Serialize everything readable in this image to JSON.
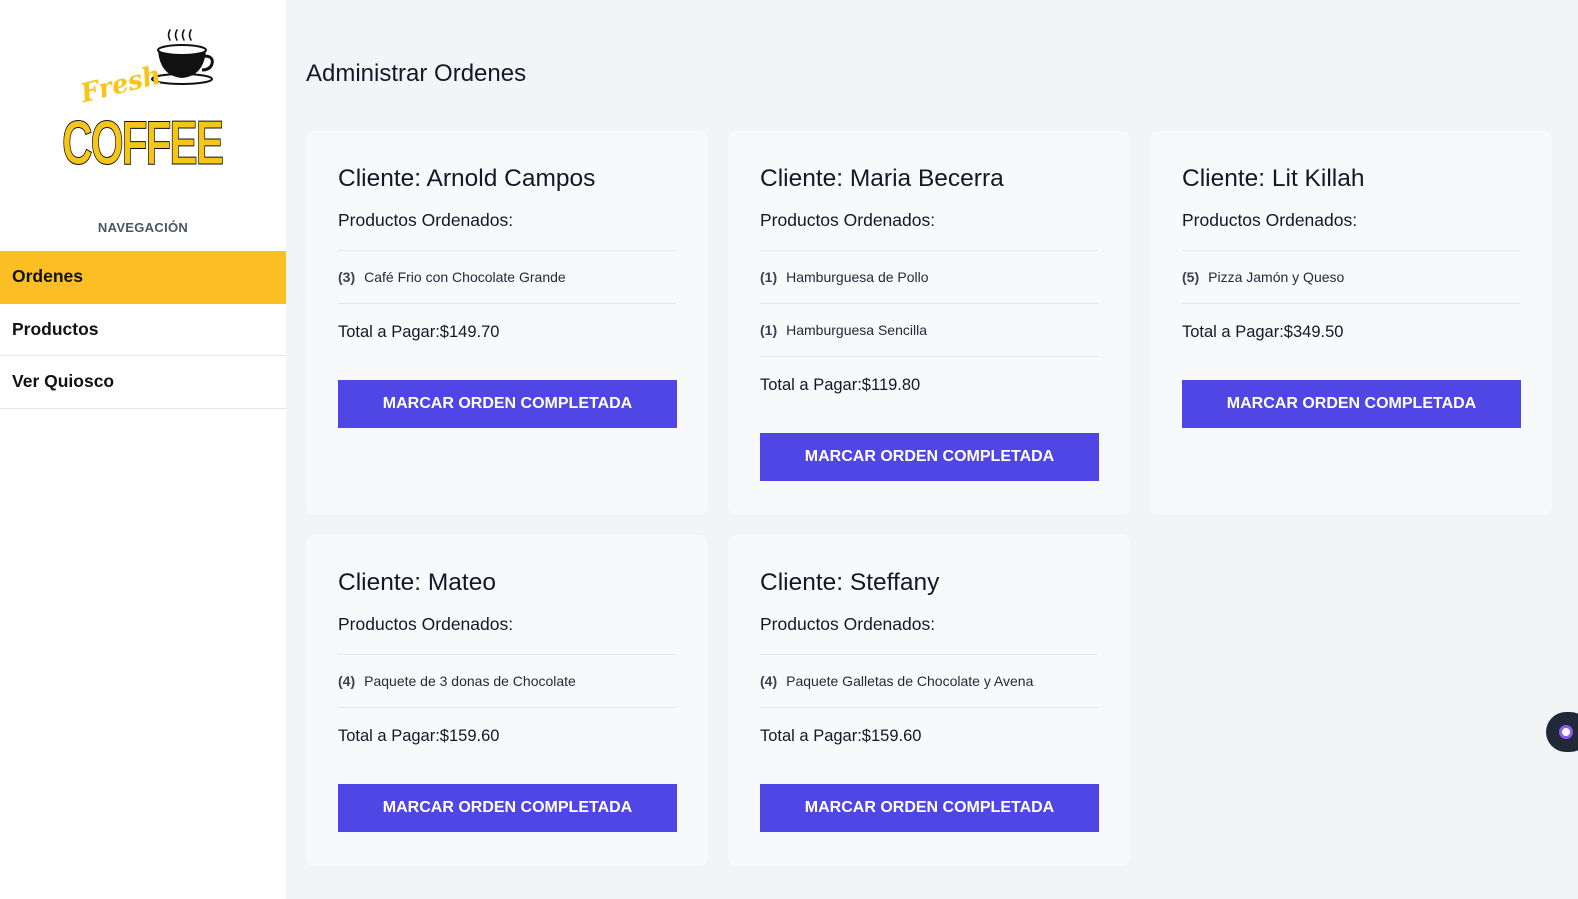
{
  "sidebar": {
    "logo_text": {
      "top": "Fresh",
      "bottom": "COFFEE"
    },
    "nav_heading": "NAVEGACIÓN",
    "items": [
      {
        "label": "Ordenes",
        "active": true
      },
      {
        "label": "Productos",
        "active": false
      },
      {
        "label": "Ver Quiosco",
        "active": false
      }
    ]
  },
  "main": {
    "title": "Administrar Ordenes",
    "orders": [
      {
        "client": "Cliente: Arnold Campos",
        "products_title": "Productos Ordenados:",
        "products": [
          {
            "qty": "(3)",
            "name": "Café Frio con Chocolate Grande"
          }
        ],
        "total": "Total a Pagar:$149.70",
        "button_label": "MARCAR ORDEN COMPLETADA"
      },
      {
        "client": "Cliente: Maria Becerra",
        "products_title": "Productos Ordenados:",
        "products": [
          {
            "qty": "(1)",
            "name": "Hamburguesa de Pollo"
          },
          {
            "qty": "(1)",
            "name": "Hamburguesa Sencilla"
          }
        ],
        "total": "Total a Pagar:$119.80",
        "button_label": "MARCAR ORDEN COMPLETADA"
      },
      {
        "client": "Cliente: Lit Killah",
        "products_title": "Productos Ordenados:",
        "products": [
          {
            "qty": "(5)",
            "name": "Pizza Jamón y Queso"
          }
        ],
        "total": "Total a Pagar:$349.50",
        "button_label": "MARCAR ORDEN COMPLETADA"
      },
      {
        "client": "Cliente: Mateo",
        "products_title": "Productos Ordenados:",
        "products": [
          {
            "qty": "(4)",
            "name": "Paquete de 3 donas de Chocolate"
          }
        ],
        "total": "Total a Pagar:$159.60",
        "button_label": "MARCAR ORDEN COMPLETADA"
      },
      {
        "client": "Cliente: Steffany",
        "products_title": "Productos Ordenados:",
        "products": [
          {
            "qty": "(4)",
            "name": "Paquete Galletas de Chocolate y Avena"
          }
        ],
        "total": "Total a Pagar:$159.60",
        "button_label": "MARCAR ORDEN COMPLETADA"
      }
    ]
  },
  "colors": {
    "accent": "#fbbf24",
    "button": "#4f46e5",
    "logo": "#f5c518"
  },
  "icons": {
    "logo": "coffee-cup-icon",
    "floating": "chat-widget-icon"
  }
}
